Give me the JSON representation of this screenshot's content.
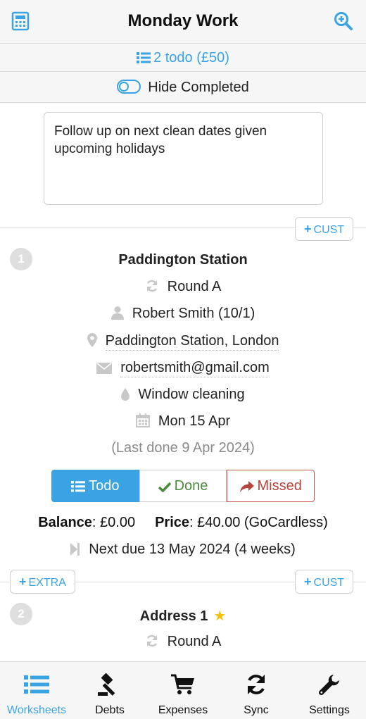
{
  "header": {
    "title": "Monday Work"
  },
  "summary": {
    "todo_text": "2 todo (£50)"
  },
  "filter": {
    "hide_completed_label": "Hide Completed"
  },
  "notes": {
    "text": "Follow up on next clean dates given upcoming holidays"
  },
  "buttons": {
    "cust_label": "CUST",
    "extra_label": "EXTRA"
  },
  "jobs": [
    {
      "number": "1",
      "name": "Paddington Station",
      "round": "Round A",
      "customer": "Robert Smith (10/1)",
      "address": "Paddington Station, London",
      "email": "robertsmith@gmail.com",
      "service": "Window cleaning",
      "date": "Mon 15 Apr",
      "last_done": "(Last done 9 Apr 2024)",
      "status_options": [
        "Todo",
        "Done",
        "Missed"
      ],
      "balance_label": "Balance",
      "balance_value": ": £0.00",
      "price_label": "Price",
      "price_value": ": £40.00 (GoCardless)",
      "next_due": "Next due 13 May 2024 (4 weeks)"
    },
    {
      "number": "2",
      "name": "Address 1",
      "round": "Round A"
    }
  ],
  "tabs": [
    {
      "label": "Worksheets",
      "icon": "list-icon"
    },
    {
      "label": "Debts",
      "icon": "gavel-icon"
    },
    {
      "label": "Expenses",
      "icon": "cart-icon"
    },
    {
      "label": "Sync",
      "icon": "sync-icon"
    },
    {
      "label": "Settings",
      "icon": "wrench-icon"
    }
  ],
  "colors": {
    "accent": "#3aa3e3",
    "done": "#4a8a3b",
    "missed": "#b5443a",
    "star": "#f4c20d"
  }
}
